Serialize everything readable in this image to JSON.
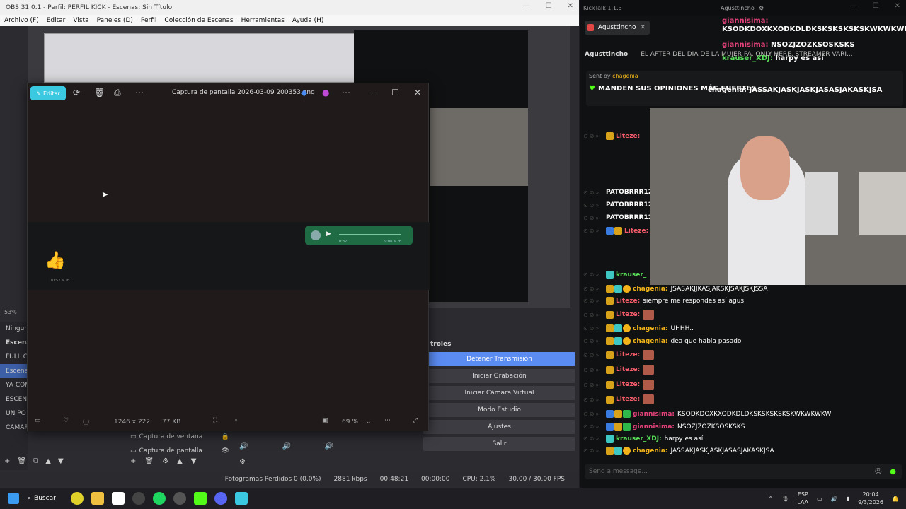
{
  "obs": {
    "title": "OBS 31.0.1 - Perfil: PERFIL KICK - Escenas: Sin Título",
    "menu": [
      "Archivo (F)",
      "Editar",
      "Vista",
      "Paneles (D)",
      "Perfil",
      "Colección de Escenas",
      "Herramientas",
      "Ayuda (H)"
    ],
    "zoom": "53%",
    "scenes_label": "Escenas",
    "scenes": [
      "Ningun",
      "FULL C",
      "Escena",
      "YA COM",
      "ESCENA",
      "UN PO",
      "CAMARA"
    ],
    "sources": [
      {
        "label": "Captura de ventana"
      },
      {
        "label": "Captura de pantalla"
      }
    ],
    "controls_title": "troles",
    "controls": [
      "Detener Transmisión",
      "Iniciar Grabación",
      "Iniciar Cámara Virtual",
      "Modo Estudio",
      "Ajustes",
      "Salir"
    ],
    "status": {
      "dropped": "Fotogramas Perdidos 0 (0.0%)",
      "bitrate": "2881 kbps",
      "live_time": "00:48:21",
      "rec_time": "00:00:00",
      "cpu": "CPU: 2.1%",
      "fps": "30.00 / 30.00 FPS"
    }
  },
  "viewer": {
    "edit_label": "Editar",
    "filename": "Captura de pantalla 2026-03-09 200353.png",
    "voice_time_left": "0:32",
    "voice_time_right": "9:08 a. m.",
    "emoji_time": "10:57 a. m.",
    "dimensions": "1246 x 222",
    "size": "77 KB",
    "zoom": "69 %"
  },
  "kicktalk": {
    "title": "KickTalk 1.1.3",
    "account": "Agusttincho",
    "tab": "Agusttincho",
    "channel": "Agusttincho",
    "stream_title": "EL AFTER DEL DIA DE LA MUJER PA. ONLY HERE. STREAMER VARI...",
    "top_messages": [
      {
        "user": "giannisima:",
        "text": "KSODKDOXKXODKDLDKSKSKSKSKSKWKWKWKW"
      },
      {
        "user": "giannisima:",
        "text": "NSOZJZOZKSOSKSKS"
      },
      {
        "user": "krauser_XDJ:",
        "text": "harpy es así"
      }
    ],
    "pinned_by": "Sent by",
    "pinned_user": "chagenia",
    "pinned_text": "MANDEN SUS OPINIONES MÁS FUERTES",
    "pinned_overlay": "chagenia: JASSAKJASKJASKJASASJAKASKJSA",
    "side_names": [
      "Liteze:",
      "PATOBRRR12",
      "PATOBRRR12",
      "PATOBRRR12",
      "Liteze:",
      "krauser_"
    ],
    "messages": [
      {
        "user": "chagenia:",
        "text": "JSASAKJJKASJAKSKJSAKJSKJSSA",
        "color": "#f2b418"
      },
      {
        "user": "Liteze:",
        "text": "siempre me respondes así agus",
        "color": "#f35a6a"
      },
      {
        "user": "Liteze:",
        "text": "",
        "color": "#f35a6a"
      },
      {
        "user": "chagenia:",
        "text": "UHHH..",
        "color": "#f2b418"
      },
      {
        "user": "chagenia:",
        "text": "dea que habia pasado",
        "color": "#f2b418"
      },
      {
        "user": "Liteze:",
        "text": "",
        "color": "#f35a6a"
      },
      {
        "user": "Liteze:",
        "text": "",
        "color": "#f35a6a"
      },
      {
        "user": "Liteze:",
        "text": "",
        "color": "#f35a6a"
      },
      {
        "user": "Liteze:",
        "text": "",
        "color": "#f35a6a"
      },
      {
        "user": "giannisima:",
        "text": "KSODKDOXKXODKDLDKSKSKSKSKSKWKWKWKW",
        "color": "#e5427a"
      },
      {
        "user": "giannisima:",
        "text": "NSOZJZOZKSOSKSKS",
        "color": "#e5427a"
      },
      {
        "user": "krauser_XDJ:",
        "text": "harpy es así",
        "color": "#59e35a"
      },
      {
        "user": "chagenia:",
        "text": "JASSAKJASKJASKJASASJAKASKJSA",
        "color": "#f2b418"
      }
    ],
    "input_placeholder": "Send a message..."
  },
  "taskbar": {
    "search": "Buscar",
    "lang1": "ESP",
    "lang2": "LAA",
    "time": "20:04",
    "date": "9/3/2026"
  },
  "colors": {
    "accent": "#5b8cf2",
    "kick_green": "#53fc18",
    "edit": "#3ac9e0"
  }
}
